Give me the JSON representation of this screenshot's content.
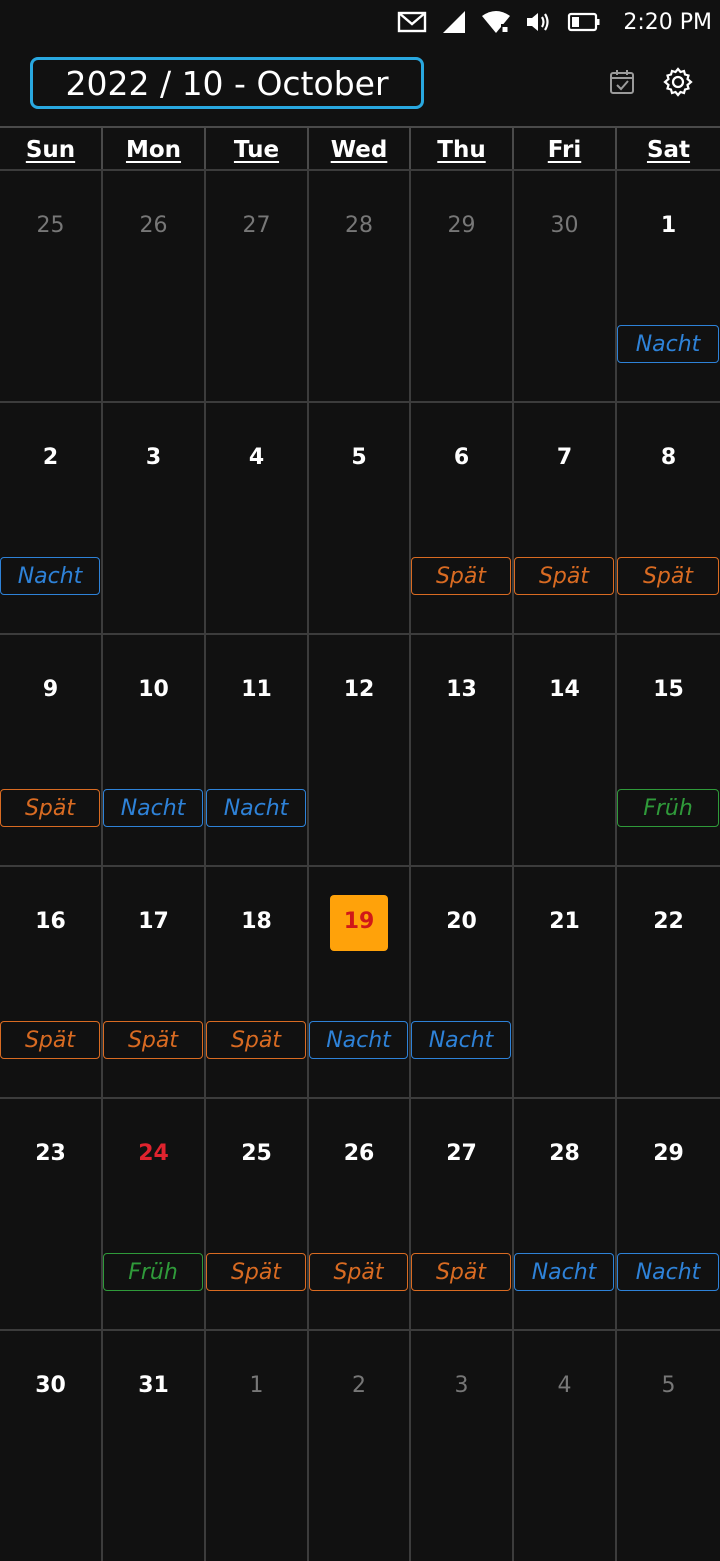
{
  "status_bar": {
    "icons": [
      "mail-icon",
      "signal-icon",
      "wifi-icon",
      "volume-icon",
      "battery-icon"
    ],
    "time": "2:20 PM"
  },
  "header": {
    "month_label": "2022 / 10 - October",
    "today_icon": "calendar-check-icon",
    "settings_icon": "gear-icon"
  },
  "colors": {
    "accent": "#29a8e0",
    "today_bg": "#ffa20a",
    "today_text": "#d01818",
    "holiday_text": "#e0232e",
    "shift_nacht": "#2e82d8",
    "shift_spaet": "#d96b22",
    "shift_frueh": "#2f9a3a"
  },
  "weekdays": [
    "Sun",
    "Mon",
    "Tue",
    "Wed",
    "Thu",
    "Fri",
    "Sat"
  ],
  "shift_types": {
    "Nacht": "nacht",
    "Spät": "spaet",
    "Früh": "frueh"
  },
  "weeks": [
    [
      {
        "day": "25",
        "muted": true,
        "shift": ""
      },
      {
        "day": "26",
        "muted": true,
        "shift": ""
      },
      {
        "day": "27",
        "muted": true,
        "shift": ""
      },
      {
        "day": "28",
        "muted": true,
        "shift": ""
      },
      {
        "day": "29",
        "muted": true,
        "shift": ""
      },
      {
        "day": "30",
        "muted": true,
        "shift": ""
      },
      {
        "day": "1",
        "shift": "Nacht"
      }
    ],
    [
      {
        "day": "2",
        "shift": "Nacht"
      },
      {
        "day": "3",
        "shift": ""
      },
      {
        "day": "4",
        "shift": ""
      },
      {
        "day": "5",
        "shift": ""
      },
      {
        "day": "6",
        "shift": "Spät"
      },
      {
        "day": "7",
        "shift": "Spät"
      },
      {
        "day": "8",
        "shift": "Spät"
      }
    ],
    [
      {
        "day": "9",
        "shift": "Spät"
      },
      {
        "day": "10",
        "shift": "Nacht"
      },
      {
        "day": "11",
        "shift": "Nacht"
      },
      {
        "day": "12",
        "shift": ""
      },
      {
        "day": "13",
        "shift": ""
      },
      {
        "day": "14",
        "shift": ""
      },
      {
        "day": "15",
        "shift": "Früh"
      }
    ],
    [
      {
        "day": "16",
        "shift": "Spät"
      },
      {
        "day": "17",
        "shift": "Spät"
      },
      {
        "day": "18",
        "shift": "Spät"
      },
      {
        "day": "19",
        "today": true,
        "shift": "Nacht"
      },
      {
        "day": "20",
        "shift": "Nacht"
      },
      {
        "day": "21",
        "shift": ""
      },
      {
        "day": "22",
        "shift": ""
      }
    ],
    [
      {
        "day": "23",
        "shift": ""
      },
      {
        "day": "24",
        "holiday": true,
        "shift": "Früh"
      },
      {
        "day": "25",
        "shift": "Spät"
      },
      {
        "day": "26",
        "shift": "Spät"
      },
      {
        "day": "27",
        "shift": "Spät"
      },
      {
        "day": "28",
        "shift": "Nacht"
      },
      {
        "day": "29",
        "shift": "Nacht"
      }
    ],
    [
      {
        "day": "30",
        "shift": ""
      },
      {
        "day": "31",
        "shift": ""
      },
      {
        "day": "1",
        "muted": true,
        "shift": ""
      },
      {
        "day": "2",
        "muted": true,
        "shift": ""
      },
      {
        "day": "3",
        "muted": true,
        "shift": ""
      },
      {
        "day": "4",
        "muted": true,
        "shift": ""
      },
      {
        "day": "5",
        "muted": true,
        "shift": ""
      }
    ]
  ]
}
